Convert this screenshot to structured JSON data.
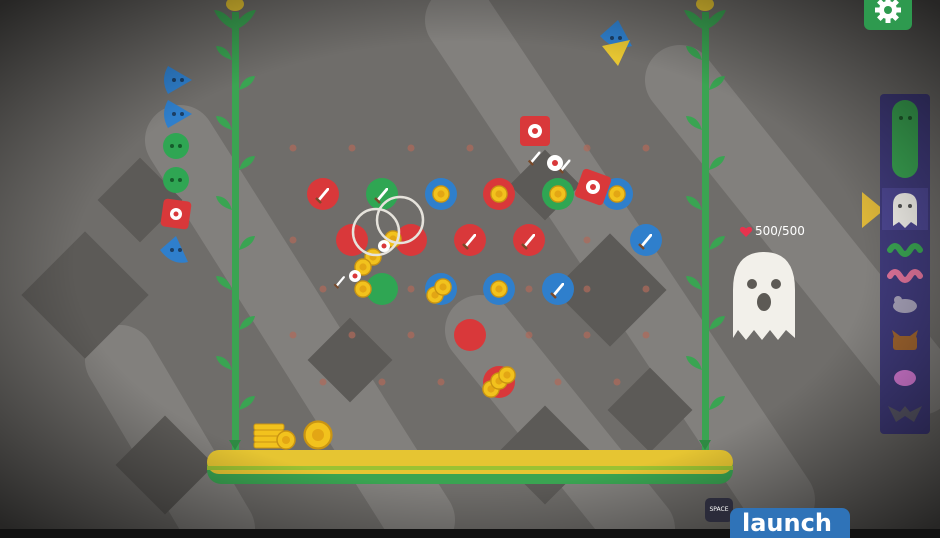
{
  "hud": {
    "enemy_hp": "500/500",
    "launch_key": "SPACE",
    "launch_label": "launch"
  },
  "icons": {
    "settings": "gear-icon",
    "heart": "heart-icon",
    "target_arrow": "triangle-right-icon"
  },
  "colors": {
    "background": "#6f6d6a",
    "stripe": "#8a8885",
    "dark_square": "#5a5856",
    "vine": "#3aa452",
    "platform_yellow": "#e6c532",
    "platform_green": "#3aa452",
    "peg_red": "#d9383a",
    "peg_green": "#2fa653",
    "peg_blue": "#2f7fcc",
    "coin": "#f2c21d",
    "panel": "#3f3a7a",
    "selector_arrow": "#e0b93a",
    "ghost": "#f2f0ea"
  },
  "enemy_queue": [
    "green-pickle",
    "ghost",
    "green-worm",
    "pink-worm",
    "grey-mouse",
    "brown-cat",
    "pink-blob",
    "grey-bat"
  ],
  "inventory_pieces": [
    "blue-triangle",
    "blue-triangle",
    "green-circle",
    "green-circle",
    "red-square",
    "blue-triangle"
  ]
}
